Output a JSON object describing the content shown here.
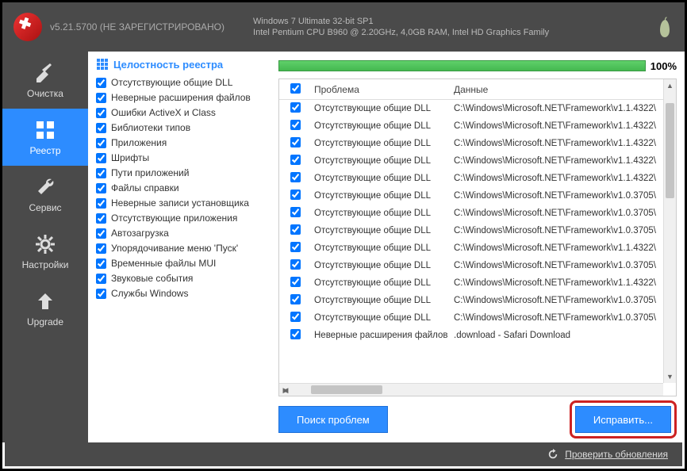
{
  "header": {
    "version": "v5.21.5700 (НЕ ЗАРЕГИСТРИРОВАНО)",
    "sys_line1": "Windows 7 Ultimate 32-bit SP1",
    "sys_line2": "Intel Pentium CPU B960 @ 2.20GHz, 4,0GB RAM, Intel HD Graphics Family"
  },
  "sidebar": {
    "items": [
      {
        "label": "Очистка"
      },
      {
        "label": "Реестр"
      },
      {
        "label": "Сервис"
      },
      {
        "label": "Настройки"
      },
      {
        "label": "Upgrade"
      }
    ]
  },
  "checks": {
    "title": "Целостность реестра",
    "items": [
      "Отсутствующие общие DLL",
      "Неверные расширения файлов",
      "Ошибки ActiveX и Class",
      "Библиотеки типов",
      "Приложения",
      "Шрифты",
      "Пути приложений",
      "Файлы справки",
      "Неверные записи установщика",
      "Отсутствующие приложения",
      "Автозагрузка",
      "Упорядочивание меню 'Пуск'",
      "Временные файлы MUI",
      "Звуковые события",
      "Службы Windows"
    ]
  },
  "progress": {
    "percent": "100%"
  },
  "table": {
    "col_problem": "Проблема",
    "col_data": "Данные",
    "rows": [
      {
        "problem": "Отсутствующие общие DLL",
        "data": "C:\\Windows\\Microsoft.NET\\Framework\\v1.1.4322\\"
      },
      {
        "problem": "Отсутствующие общие DLL",
        "data": "C:\\Windows\\Microsoft.NET\\Framework\\v1.1.4322\\"
      },
      {
        "problem": "Отсутствующие общие DLL",
        "data": "C:\\Windows\\Microsoft.NET\\Framework\\v1.1.4322\\"
      },
      {
        "problem": "Отсутствующие общие DLL",
        "data": "C:\\Windows\\Microsoft.NET\\Framework\\v1.1.4322\\"
      },
      {
        "problem": "Отсутствующие общие DLL",
        "data": "C:\\Windows\\Microsoft.NET\\Framework\\v1.1.4322\\"
      },
      {
        "problem": "Отсутствующие общие DLL",
        "data": "C:\\Windows\\Microsoft.NET\\Framework\\v1.0.3705\\"
      },
      {
        "problem": "Отсутствующие общие DLL",
        "data": "C:\\Windows\\Microsoft.NET\\Framework\\v1.0.3705\\"
      },
      {
        "problem": "Отсутствующие общие DLL",
        "data": "C:\\Windows\\Microsoft.NET\\Framework\\v1.0.3705\\"
      },
      {
        "problem": "Отсутствующие общие DLL",
        "data": "C:\\Windows\\Microsoft.NET\\Framework\\v1.1.4322\\"
      },
      {
        "problem": "Отсутствующие общие DLL",
        "data": "C:\\Windows\\Microsoft.NET\\Framework\\v1.0.3705\\"
      },
      {
        "problem": "Отсутствующие общие DLL",
        "data": "C:\\Windows\\Microsoft.NET\\Framework\\v1.1.4322\\"
      },
      {
        "problem": "Отсутствующие общие DLL",
        "data": "C:\\Windows\\Microsoft.NET\\Framework\\v1.0.3705\\"
      },
      {
        "problem": "Отсутствующие общие DLL",
        "data": "C:\\Windows\\Microsoft.NET\\Framework\\v1.0.3705\\"
      },
      {
        "problem": "Неверные расширения файлов",
        "data": ".download - Safari Download"
      }
    ]
  },
  "buttons": {
    "scan": "Поиск проблем",
    "fix": "Исправить..."
  },
  "status": {
    "check_updates": "Проверить обновления"
  }
}
